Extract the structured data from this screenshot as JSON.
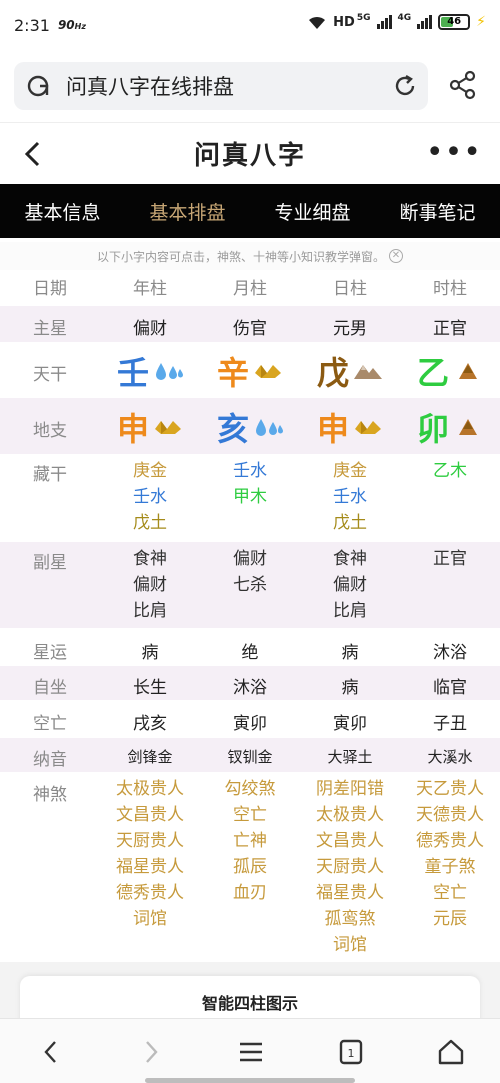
{
  "status": {
    "time": "2:31",
    "refresh_rate": "90",
    "refresh_unit": "Hz",
    "hd": "HD",
    "net1": "5G",
    "net2": "4G",
    "battery": "46"
  },
  "search": {
    "text": "问真八字在线排盘"
  },
  "header": {
    "title": "问真八字"
  },
  "tabs": [
    {
      "label": "基本信息"
    },
    {
      "label": "基本排盘"
    },
    {
      "label": "专业细盘"
    },
    {
      "label": "断事笔记"
    }
  ],
  "hint": "以下小字内容可点击，神煞、十神等小知识教学弹窗。",
  "table": {
    "headers": [
      "日期",
      "年柱",
      "月柱",
      "日柱",
      "时柱"
    ],
    "zhuxing": {
      "label": "主星",
      "values": [
        "偏财",
        "伤官",
        "元男",
        "正官"
      ]
    },
    "tiangan": {
      "label": "天干",
      "values": [
        "壬",
        "辛",
        "戊",
        "乙"
      ]
    },
    "dizhi": {
      "label": "地支",
      "values": [
        "申",
        "亥",
        "申",
        "卯"
      ]
    },
    "canggan": {
      "label": "藏干",
      "cols": [
        [
          "庚金",
          "壬水",
          "戊土"
        ],
        [
          "壬水",
          "甲木"
        ],
        [
          "庚金",
          "壬水",
          "戊土"
        ],
        [
          "乙木"
        ]
      ]
    },
    "fuxing": {
      "label": "副星",
      "cols": [
        [
          "食神",
          "偏财",
          "比肩"
        ],
        [
          "偏财",
          "七杀"
        ],
        [
          "食神",
          "偏财",
          "比肩"
        ],
        [
          "正官"
        ]
      ]
    },
    "xingyun": {
      "label": "星运",
      "values": [
        "病",
        "绝",
        "病",
        "沐浴"
      ]
    },
    "zizuo": {
      "label": "自坐",
      "values": [
        "长生",
        "沐浴",
        "病",
        "临官"
      ]
    },
    "kongwang": {
      "label": "空亡",
      "values": [
        "戌亥",
        "寅卯",
        "寅卯",
        "子丑"
      ]
    },
    "nayin": {
      "label": "纳音",
      "values": [
        "剑锋金",
        "钗钏金",
        "大驿土",
        "大溪水"
      ]
    },
    "shensha": {
      "label": "神煞",
      "cols": [
        [
          "太极贵人",
          "文昌贵人",
          "天厨贵人",
          "福星贵人",
          "德秀贵人",
          "词馆"
        ],
        [
          "勾绞煞",
          "空亡",
          "亡神",
          "孤辰",
          "血刃"
        ],
        [
          "阴差阳错",
          "太极贵人",
          "文昌贵人",
          "天厨贵人",
          "福星贵人",
          "孤鸾煞",
          "词馆"
        ],
        [
          "天乙贵人",
          "天德贵人",
          "德秀贵人",
          "童子煞",
          "空亡",
          "元辰"
        ]
      ]
    }
  },
  "panel": {
    "title": "智能四柱图示"
  },
  "colors": {
    "tab_bg": "#050505",
    "tab_active": "#c7a675",
    "gold": "#c69a3c",
    "water_blue": "#3479d6",
    "wood_green": "#2ecc40",
    "metal_orange": "#ee8a1c",
    "earth_brown": "#8b5a12",
    "row_shade": "#f5eff6"
  },
  "icons": {
    "element_icons": [
      "water-drops-icon",
      "gold-ingot-icon",
      "mountain-icon",
      "tree-icon"
    ]
  }
}
